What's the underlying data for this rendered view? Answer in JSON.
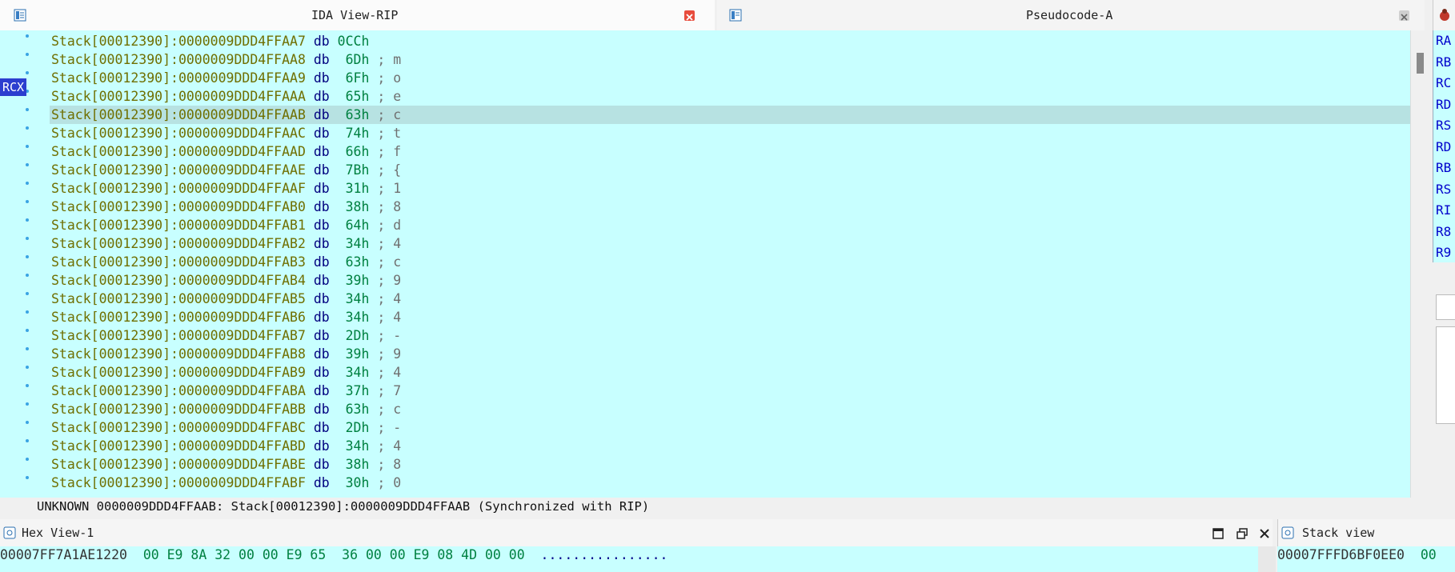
{
  "ida_view": {
    "title": "IDA View-RIP",
    "register_tag": "RCX",
    "lines": [
      {
        "seg": "Stack[00012390]:0000009DDD4FFAA7",
        "kw": "db",
        "num": "0CCh",
        "cmt": ""
      },
      {
        "seg": "Stack[00012390]:0000009DDD4FFAA8",
        "kw": "db",
        "num": " 6Dh",
        "cmt": " ; m"
      },
      {
        "seg": "Stack[00012390]:0000009DDD4FFAA9",
        "kw": "db",
        "num": " 6Fh",
        "cmt": " ; o"
      },
      {
        "seg": "Stack[00012390]:0000009DDD4FFAAA",
        "kw": "db",
        "num": " 65h",
        "cmt": " ; e"
      },
      {
        "seg": "Stack[00012390]:0000009DDD4FFAAB",
        "kw": "db",
        "num": " 63h",
        "cmt": " ; c"
      },
      {
        "seg": "Stack[00012390]:0000009DDD4FFAAC",
        "kw": "db",
        "num": " 74h",
        "cmt": " ; t"
      },
      {
        "seg": "Stack[00012390]:0000009DDD4FFAAD",
        "kw": "db",
        "num": " 66h",
        "cmt": " ; f"
      },
      {
        "seg": "Stack[00012390]:0000009DDD4FFAAE",
        "kw": "db",
        "num": " 7Bh",
        "cmt": " ; {"
      },
      {
        "seg": "Stack[00012390]:0000009DDD4FFAAF",
        "kw": "db",
        "num": " 31h",
        "cmt": " ; 1"
      },
      {
        "seg": "Stack[00012390]:0000009DDD4FFAB0",
        "kw": "db",
        "num": " 38h",
        "cmt": " ; 8"
      },
      {
        "seg": "Stack[00012390]:0000009DDD4FFAB1",
        "kw": "db",
        "num": " 64h",
        "cmt": " ; d"
      },
      {
        "seg": "Stack[00012390]:0000009DDD4FFAB2",
        "kw": "db",
        "num": " 34h",
        "cmt": " ; 4"
      },
      {
        "seg": "Stack[00012390]:0000009DDD4FFAB3",
        "kw": "db",
        "num": " 63h",
        "cmt": " ; c"
      },
      {
        "seg": "Stack[00012390]:0000009DDD4FFAB4",
        "kw": "db",
        "num": " 39h",
        "cmt": " ; 9"
      },
      {
        "seg": "Stack[00012390]:0000009DDD4FFAB5",
        "kw": "db",
        "num": " 34h",
        "cmt": " ; 4"
      },
      {
        "seg": "Stack[00012390]:0000009DDD4FFAB6",
        "kw": "db",
        "num": " 34h",
        "cmt": " ; 4"
      },
      {
        "seg": "Stack[00012390]:0000009DDD4FFAB7",
        "kw": "db",
        "num": " 2Dh",
        "cmt": " ; -"
      },
      {
        "seg": "Stack[00012390]:0000009DDD4FFAB8",
        "kw": "db",
        "num": " 39h",
        "cmt": " ; 9"
      },
      {
        "seg": "Stack[00012390]:0000009DDD4FFAB9",
        "kw": "db",
        "num": " 34h",
        "cmt": " ; 4"
      },
      {
        "seg": "Stack[00012390]:0000009DDD4FFABA",
        "kw": "db",
        "num": " 37h",
        "cmt": " ; 7"
      },
      {
        "seg": "Stack[00012390]:0000009DDD4FFABB",
        "kw": "db",
        "num": " 63h",
        "cmt": " ; c"
      },
      {
        "seg": "Stack[00012390]:0000009DDD4FFABC",
        "kw": "db",
        "num": " 2Dh",
        "cmt": " ; -"
      },
      {
        "seg": "Stack[00012390]:0000009DDD4FFABD",
        "kw": "db",
        "num": " 34h",
        "cmt": " ; 4"
      },
      {
        "seg": "Stack[00012390]:0000009DDD4FFABE",
        "kw": "db",
        "num": " 38h",
        "cmt": " ; 8"
      },
      {
        "seg": "Stack[00012390]:0000009DDD4FFABF",
        "kw": "db",
        "num": " 30h",
        "cmt": " ; 0"
      }
    ],
    "selected_index": 4,
    "status_text": "UNKNOWN 0000009DDD4FFAAB: Stack[00012390]:0000009DDD4FFAAB (Synchronized with RIP)"
  },
  "pseudocode": {
    "title": "Pseudocode-A"
  },
  "registers": [
    "RA",
    "RB",
    "RC",
    "RD",
    "RS",
    "RD",
    "RB",
    "RS",
    "RI",
    "R8",
    "R9"
  ],
  "hex_view": {
    "title": "Hex View-1",
    "lines": [
      {
        "addr": "00007FF7A1AE1220",
        "bytes": "00 E9 8A 32 00 00 E9 65  36 00 00 E9 08 4D 00 00",
        "ascii": "................"
      }
    ]
  },
  "stack_view": {
    "title": "Stack view",
    "lines": [
      {
        "addr": "00007FFFD6BF0EE0",
        "val": "00"
      }
    ]
  },
  "icons": [
    "ida-view-icon",
    "close-icon",
    "pseudocode-icon",
    "debug-icon",
    "hex-view-icon",
    "stack-view-icon",
    "maximize-icon",
    "restore-icon"
  ],
  "colors": {
    "background": "#c8ffff",
    "segment": "#6f6f00",
    "keyword": "#00007f",
    "number": "#008040",
    "comment": "#707070",
    "register_tag": "#2c3ecf"
  }
}
